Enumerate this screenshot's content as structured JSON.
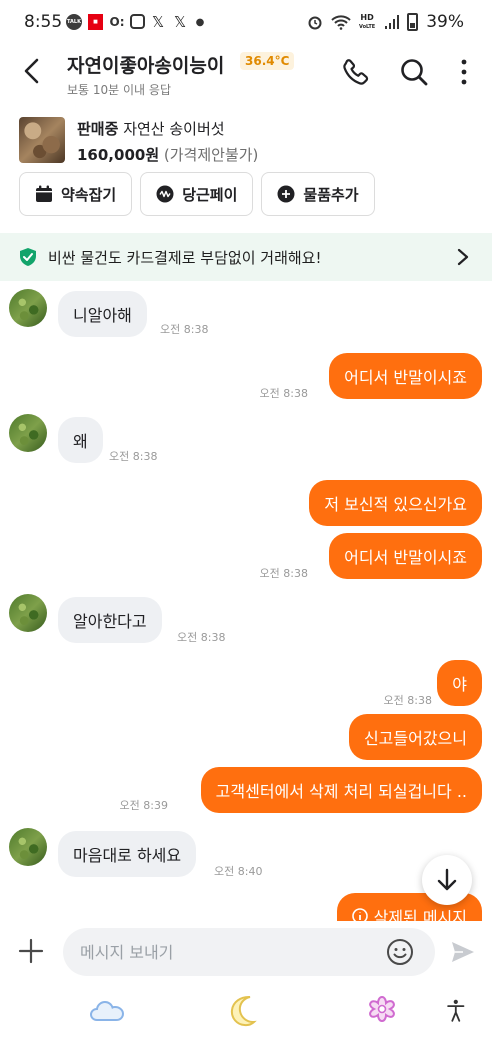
{
  "status_bar": {
    "time": "8:55",
    "talk_label": "TALK",
    "network_label": "HD",
    "network_sub": "VoLTE",
    "battery": "39%"
  },
  "header": {
    "user_name": "자연이좋아송이능이",
    "temperature": "36.4°C",
    "response_time": "보통 10분 이내 응답"
  },
  "product": {
    "status": "판매중",
    "title": "자연산 송이버섯",
    "price": "160,000원",
    "negotiation": "(가격제안불가)"
  },
  "actions": [
    {
      "label": "약속잡기",
      "icon": "calendar-icon"
    },
    {
      "label": "당근페이",
      "icon": "pay-icon"
    },
    {
      "label": "물품추가",
      "icon": "plus-circle-icon"
    }
  ],
  "banner": {
    "text": "비싼 물건도 카드결제로 부담없이 거래해요!"
  },
  "messages": [
    {
      "side": "in",
      "text": "니알아해",
      "time": "오전 8:38",
      "avatar": true
    },
    {
      "side": "out",
      "text": "어디서 반말이시죠",
      "time": "오전 8:38"
    },
    {
      "side": "in",
      "text": "왜",
      "time": "오전 8:38",
      "avatar": true
    },
    {
      "side": "out",
      "text": "저 보신적 있으신가요",
      "time": ""
    },
    {
      "side": "out",
      "text": "어디서 반말이시죠",
      "time": "오전 8:38"
    },
    {
      "side": "in",
      "text": "알아한다고",
      "time": "오전 8:38",
      "avatar": true
    },
    {
      "side": "out",
      "text": "야",
      "time": "오전 8:38"
    },
    {
      "side": "out",
      "text": "신고들어갔으니",
      "time": ""
    },
    {
      "side": "out",
      "text": "고객센터에서 삭제 처리 되실겁니다 ..",
      "time": "오전 8:39"
    },
    {
      "side": "in",
      "text": "마음대로 하세요",
      "time": "오전 8:40",
      "avatar": true
    }
  ],
  "partial_message": "삭제된 메시지",
  "composer": {
    "placeholder": "메시지 보내기"
  },
  "colors": {
    "brand_orange": "#ff6f0f",
    "banner_bg": "#eef7f2",
    "temperature": "#e08a00"
  }
}
